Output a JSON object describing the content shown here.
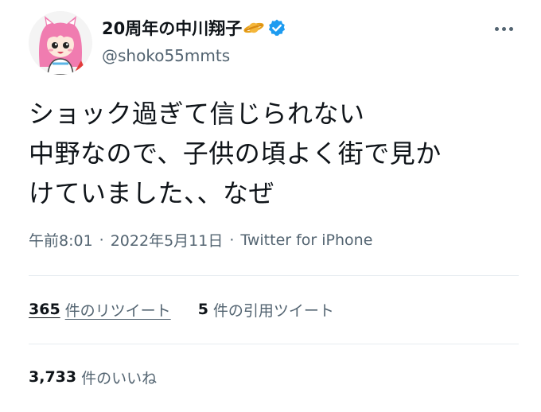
{
  "user": {
    "display_name": "20周年の中川翔子",
    "handle": "@shoko55mmts",
    "verified": true,
    "emoji_icon": "ringed-planet",
    "accent_color": "#1d9bf0"
  },
  "tweet": {
    "lines": [
      "ショック過ぎて信じられない",
      "中野なので、子供の頃よく街で見か",
      "けていました、、なぜ"
    ]
  },
  "meta": {
    "time": "午前8:01",
    "separator": "·",
    "date": "2022年5月11日",
    "source": "Twitter for iPhone"
  },
  "stats": {
    "retweets_count": "365",
    "retweets_label": "件のリツイート",
    "quotes_count": "5",
    "quotes_label": "件の引用ツイート",
    "likes_count": "3,733",
    "likes_label": "件のいいね"
  }
}
